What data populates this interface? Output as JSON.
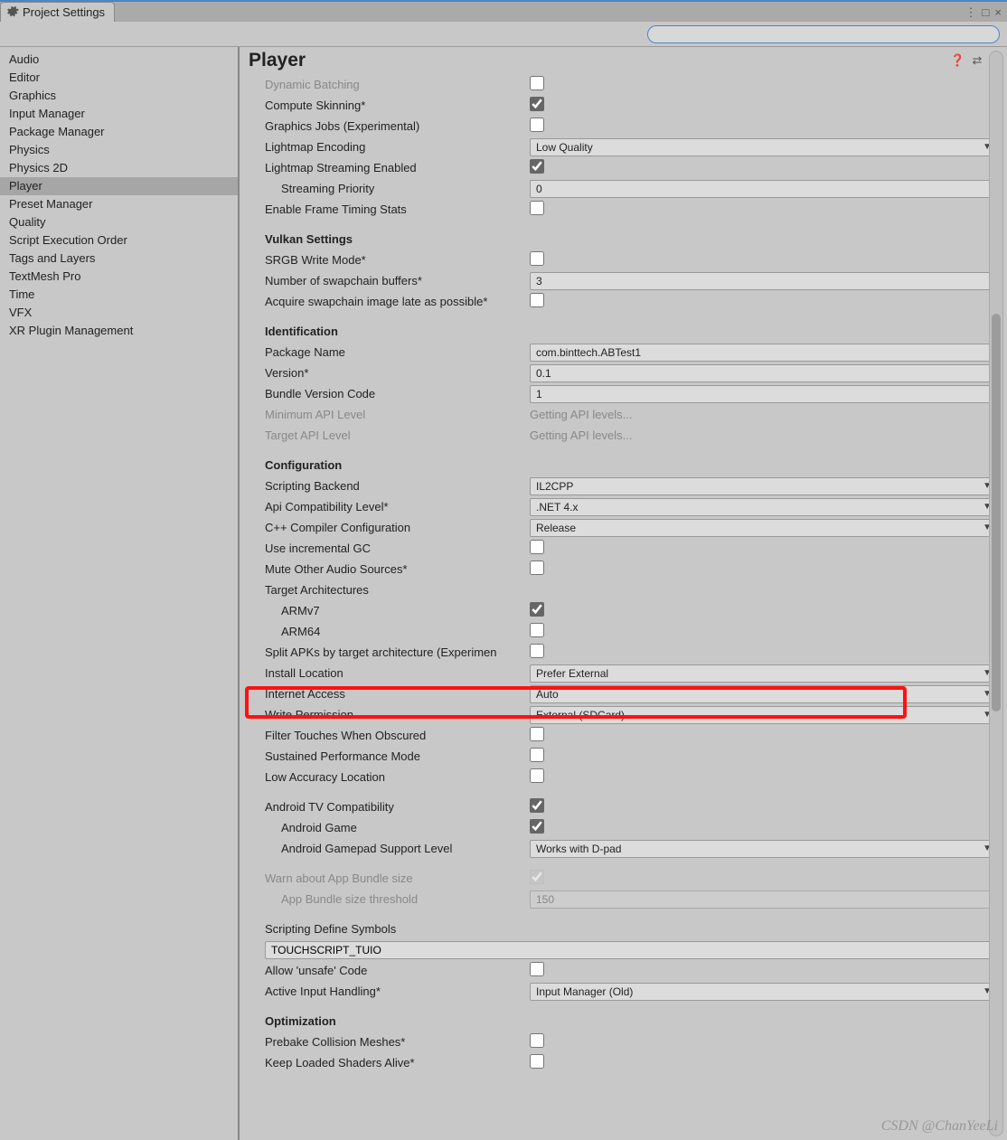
{
  "tab": {
    "title": "Project Settings"
  },
  "search": {
    "placeholder": ""
  },
  "sidebar": {
    "items": [
      {
        "label": "Audio"
      },
      {
        "label": "Editor"
      },
      {
        "label": "Graphics"
      },
      {
        "label": "Input Manager"
      },
      {
        "label": "Package Manager"
      },
      {
        "label": "Physics"
      },
      {
        "label": "Physics 2D"
      },
      {
        "label": "Player",
        "selected": true
      },
      {
        "label": "Preset Manager"
      },
      {
        "label": "Quality"
      },
      {
        "label": "Script Execution Order"
      },
      {
        "label": "Tags and Layers"
      },
      {
        "label": "TextMesh Pro"
      },
      {
        "label": "Time"
      },
      {
        "label": "VFX"
      },
      {
        "label": "XR Plugin Management"
      }
    ]
  },
  "header": {
    "title": "Player"
  },
  "settings": {
    "dynamic_batching": {
      "label": "Dynamic Batching",
      "checked": false
    },
    "compute_skinning": {
      "label": "Compute Skinning*",
      "checked": true
    },
    "graphics_jobs": {
      "label": "Graphics Jobs (Experimental)",
      "checked": false
    },
    "lightmap_encoding": {
      "label": "Lightmap Encoding",
      "value": "Low Quality"
    },
    "lightmap_streaming": {
      "label": "Lightmap Streaming Enabled",
      "checked": true
    },
    "streaming_priority": {
      "label": "Streaming Priority",
      "value": "0"
    },
    "frame_timing": {
      "label": "Enable Frame Timing Stats",
      "checked": false
    },
    "section_vulkan": "Vulkan Settings",
    "srgb_write": {
      "label": "SRGB Write Mode*",
      "checked": false
    },
    "swapchain_buffers": {
      "label": "Number of swapchain buffers*",
      "value": "3"
    },
    "acquire_late": {
      "label": "Acquire swapchain image late as possible*",
      "checked": false
    },
    "section_identification": "Identification",
    "package_name": {
      "label": "Package Name",
      "value": "com.binttech.ABTest1"
    },
    "version": {
      "label": "Version*",
      "value": "0.1"
    },
    "bundle_version": {
      "label": "Bundle Version Code",
      "value": "1"
    },
    "min_api": {
      "label": "Minimum API Level",
      "value": "Getting API levels..."
    },
    "target_api": {
      "label": "Target API Level",
      "value": "Getting API levels..."
    },
    "section_config": "Configuration",
    "scripting_backend": {
      "label": "Scripting Backend",
      "value": "IL2CPP"
    },
    "api_compat": {
      "label": "Api Compatibility Level*",
      "value": ".NET 4.x"
    },
    "cpp_compiler": {
      "label": "C++ Compiler Configuration",
      "value": "Release"
    },
    "incremental_gc": {
      "label": "Use incremental GC",
      "checked": false
    },
    "mute_audio": {
      "label": "Mute Other Audio Sources*",
      "checked": false
    },
    "target_arch": {
      "label": "Target Architectures"
    },
    "armv7": {
      "label": "ARMv7",
      "checked": true
    },
    "arm64": {
      "label": "ARM64",
      "checked": false
    },
    "split_apk": {
      "label": "Split APKs by target architecture (Experimen",
      "checked": false
    },
    "install_location": {
      "label": "Install Location",
      "value": "Prefer External"
    },
    "internet_access": {
      "label": "Internet Access",
      "value": "Auto"
    },
    "write_permission": {
      "label": "Write Permission",
      "value": "External (SDCard)"
    },
    "filter_touches": {
      "label": "Filter Touches When Obscured",
      "checked": false
    },
    "sustained_perf": {
      "label": "Sustained Performance Mode",
      "checked": false
    },
    "low_accuracy": {
      "label": "Low Accuracy Location",
      "checked": false
    },
    "tv_compat": {
      "label": "Android TV Compatibility",
      "checked": true
    },
    "android_game": {
      "label": "Android Game",
      "checked": true
    },
    "gamepad_support": {
      "label": "Android Gamepad Support Level",
      "value": "Works with D-pad"
    },
    "warn_bundle": {
      "label": "Warn about App Bundle size",
      "checked": true
    },
    "bundle_threshold": {
      "label": "App Bundle size threshold",
      "value": "150"
    },
    "define_symbols": {
      "label": "Scripting Define Symbols",
      "value": "TOUCHSCRIPT_TUIO"
    },
    "unsafe_code": {
      "label": "Allow 'unsafe' Code",
      "checked": false
    },
    "active_input": {
      "label": "Active Input Handling*",
      "value": "Input Manager (Old)"
    },
    "section_optimization": "Optimization",
    "prebake_collision": {
      "label": "Prebake Collision Meshes*",
      "checked": false
    },
    "keep_shaders": {
      "label": "Keep Loaded Shaders Alive*",
      "checked": false
    }
  },
  "watermark": "CSDN @ChanYeeLi"
}
